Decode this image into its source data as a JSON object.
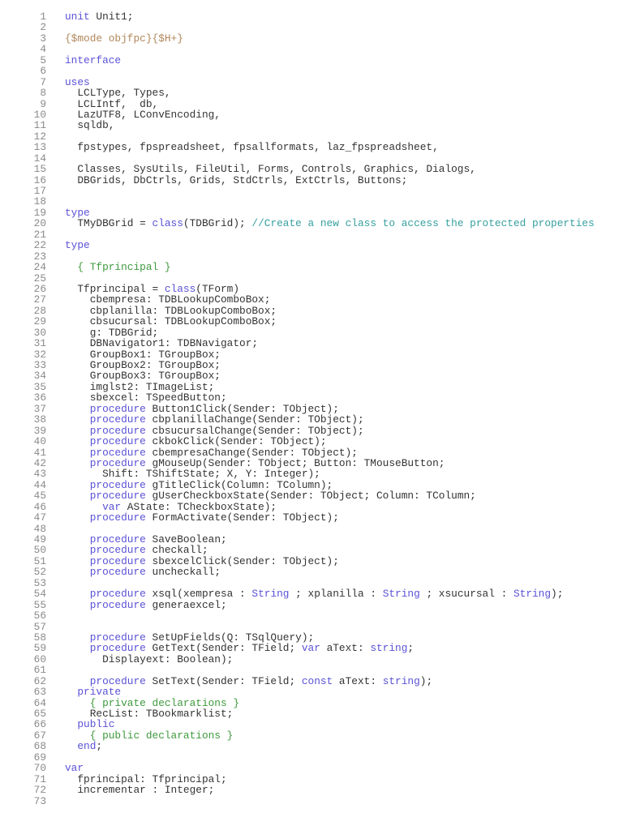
{
  "colors": {
    "keyword": "#5a52d6",
    "directive": "#b0875a",
    "comment_brace": "#3f9a3f",
    "comment_line": "#37a0a0",
    "text": "#333333",
    "line_number": "#8a8a8a"
  },
  "lines": [
    {
      "n": "1",
      "tokens": [
        [
          "k",
          "unit"
        ],
        [
          "p",
          " Unit1;"
        ]
      ]
    },
    {
      "n": "2",
      "tokens": []
    },
    {
      "n": "3",
      "tokens": [
        [
          "d",
          "{$mode objfpc}{$H+}"
        ]
      ]
    },
    {
      "n": "4",
      "tokens": []
    },
    {
      "n": "5",
      "tokens": [
        [
          "k",
          "interface"
        ]
      ]
    },
    {
      "n": "6",
      "tokens": []
    },
    {
      "n": "7",
      "tokens": [
        [
          "k",
          "uses"
        ]
      ]
    },
    {
      "n": "8",
      "tokens": [
        [
          "p",
          "  LCLType, Types,"
        ]
      ]
    },
    {
      "n": "9",
      "tokens": [
        [
          "p",
          "  LCLIntf,  db,"
        ]
      ]
    },
    {
      "n": "10",
      "tokens": [
        [
          "p",
          "  LazUTF8, LConvEncoding,"
        ]
      ]
    },
    {
      "n": "11",
      "tokens": [
        [
          "p",
          "  sqldb,"
        ]
      ]
    },
    {
      "n": "12",
      "tokens": []
    },
    {
      "n": "13",
      "tokens": [
        [
          "p",
          "  fpstypes, fpspreadsheet, fpsallformats, laz_fpspreadsheet,"
        ]
      ]
    },
    {
      "n": "14",
      "tokens": []
    },
    {
      "n": "15",
      "tokens": [
        [
          "p",
          "  Classes, SysUtils, FileUtil, Forms, Controls, Graphics, Dialogs,"
        ]
      ]
    },
    {
      "n": "16",
      "tokens": [
        [
          "p",
          "  DBGrids, DbCtrls, Grids, StdCtrls, ExtCtrls, Buttons;"
        ]
      ]
    },
    {
      "n": "17",
      "tokens": []
    },
    {
      "n": "18",
      "tokens": []
    },
    {
      "n": "19",
      "tokens": [
        [
          "k",
          "type"
        ]
      ]
    },
    {
      "n": "20",
      "tokens": [
        [
          "p",
          "  TMyDBGrid = "
        ],
        [
          "k",
          "class"
        ],
        [
          "p",
          "(TDBGrid); "
        ],
        [
          "t",
          "//Create a new class to access the protected properties"
        ]
      ]
    },
    {
      "n": "21",
      "tokens": []
    },
    {
      "n": "22",
      "tokens": [
        [
          "k",
          "type"
        ]
      ]
    },
    {
      "n": "23",
      "tokens": []
    },
    {
      "n": "24",
      "tokens": [
        [
          "c",
          "  { Tfprincipal }"
        ]
      ]
    },
    {
      "n": "25",
      "tokens": []
    },
    {
      "n": "26",
      "tokens": [
        [
          "p",
          "  Tfprincipal = "
        ],
        [
          "k",
          "class"
        ],
        [
          "p",
          "(TForm)"
        ]
      ]
    },
    {
      "n": "27",
      "tokens": [
        [
          "p",
          "    cbempresa: TDBLookupComboBox;"
        ]
      ]
    },
    {
      "n": "28",
      "tokens": [
        [
          "p",
          "    cbplanilla: TDBLookupComboBox;"
        ]
      ]
    },
    {
      "n": "29",
      "tokens": [
        [
          "p",
          "    cbsucursal: TDBLookupComboBox;"
        ]
      ]
    },
    {
      "n": "30",
      "tokens": [
        [
          "p",
          "    g: TDBGrid;"
        ]
      ]
    },
    {
      "n": "31",
      "tokens": [
        [
          "p",
          "    DBNavigator1: TDBNavigator;"
        ]
      ]
    },
    {
      "n": "32",
      "tokens": [
        [
          "p",
          "    GroupBox1: TGroupBox;"
        ]
      ]
    },
    {
      "n": "33",
      "tokens": [
        [
          "p",
          "    GroupBox2: TGroupBox;"
        ]
      ]
    },
    {
      "n": "34",
      "tokens": [
        [
          "p",
          "    GroupBox3: TGroupBox;"
        ]
      ]
    },
    {
      "n": "35",
      "tokens": [
        [
          "p",
          "    imglst2: TImageList;"
        ]
      ]
    },
    {
      "n": "36",
      "tokens": [
        [
          "p",
          "    sbexcel: TSpeedButton;"
        ]
      ]
    },
    {
      "n": "37",
      "tokens": [
        [
          "p",
          "    "
        ],
        [
          "k",
          "procedure"
        ],
        [
          "p",
          " Button1Click(Sender: TObject);"
        ]
      ]
    },
    {
      "n": "38",
      "tokens": [
        [
          "p",
          "    "
        ],
        [
          "k",
          "procedure"
        ],
        [
          "p",
          " cbplanillaChange(Sender: TObject);"
        ]
      ]
    },
    {
      "n": "39",
      "tokens": [
        [
          "p",
          "    "
        ],
        [
          "k",
          "procedure"
        ],
        [
          "p",
          " cbsucursalChange(Sender: TObject);"
        ]
      ]
    },
    {
      "n": "40",
      "tokens": [
        [
          "p",
          "    "
        ],
        [
          "k",
          "procedure"
        ],
        [
          "p",
          " ckbokClick(Sender: TObject);"
        ]
      ]
    },
    {
      "n": "41",
      "tokens": [
        [
          "p",
          "    "
        ],
        [
          "k",
          "procedure"
        ],
        [
          "p",
          " cbempresaChange(Sender: TObject);"
        ]
      ]
    },
    {
      "n": "42",
      "tokens": [
        [
          "p",
          "    "
        ],
        [
          "k",
          "procedure"
        ],
        [
          "p",
          " gMouseUp(Sender: TObject; Button: TMouseButton;"
        ]
      ]
    },
    {
      "n": "43",
      "tokens": [
        [
          "p",
          "      Shift: TShiftState; X, Y: Integer);"
        ]
      ]
    },
    {
      "n": "44",
      "tokens": [
        [
          "p",
          "    "
        ],
        [
          "k",
          "procedure"
        ],
        [
          "p",
          " gTitleClick(Column: TColumn);"
        ]
      ]
    },
    {
      "n": "45",
      "tokens": [
        [
          "p",
          "    "
        ],
        [
          "k",
          "procedure"
        ],
        [
          "p",
          " gUserCheckboxState(Sender: TObject; Column: TColumn;"
        ]
      ]
    },
    {
      "n": "46",
      "tokens": [
        [
          "p",
          "      "
        ],
        [
          "k",
          "var"
        ],
        [
          "p",
          " AState: TCheckboxState);"
        ]
      ]
    },
    {
      "n": "47",
      "tokens": [
        [
          "p",
          "    "
        ],
        [
          "k",
          "procedure"
        ],
        [
          "p",
          " FormActivate(Sender: TObject);"
        ]
      ]
    },
    {
      "n": "48",
      "tokens": []
    },
    {
      "n": "49",
      "tokens": [
        [
          "p",
          "    "
        ],
        [
          "k",
          "procedure"
        ],
        [
          "p",
          " SaveBoolean;"
        ]
      ]
    },
    {
      "n": "50",
      "tokens": [
        [
          "p",
          "    "
        ],
        [
          "k",
          "procedure"
        ],
        [
          "p",
          " checkall;"
        ]
      ]
    },
    {
      "n": "51",
      "tokens": [
        [
          "p",
          "    "
        ],
        [
          "k",
          "procedure"
        ],
        [
          "p",
          " sbexcelClick(Sender: TObject);"
        ]
      ]
    },
    {
      "n": "52",
      "tokens": [
        [
          "p",
          "    "
        ],
        [
          "k",
          "procedure"
        ],
        [
          "p",
          " uncheckall;"
        ]
      ]
    },
    {
      "n": "53",
      "tokens": []
    },
    {
      "n": "54",
      "tokens": [
        [
          "p",
          "    "
        ],
        [
          "k",
          "procedure"
        ],
        [
          "p",
          " xsql(xempresa : "
        ],
        [
          "k",
          "String"
        ],
        [
          "p",
          " ; xplanilla : "
        ],
        [
          "k",
          "String"
        ],
        [
          "p",
          " ; xsucursal : "
        ],
        [
          "k",
          "String"
        ],
        [
          "p",
          ");"
        ]
      ]
    },
    {
      "n": "55",
      "tokens": [
        [
          "p",
          "    "
        ],
        [
          "k",
          "procedure"
        ],
        [
          "p",
          " generaexcel;"
        ]
      ]
    },
    {
      "n": "56",
      "tokens": []
    },
    {
      "n": "57",
      "tokens": []
    },
    {
      "n": "58",
      "tokens": [
        [
          "p",
          "    "
        ],
        [
          "k",
          "procedure"
        ],
        [
          "p",
          " SetUpFields(Q: TSqlQuery);"
        ]
      ]
    },
    {
      "n": "59",
      "tokens": [
        [
          "p",
          "    "
        ],
        [
          "k",
          "procedure"
        ],
        [
          "p",
          " GetText(Sender: TField; "
        ],
        [
          "k",
          "var"
        ],
        [
          "p",
          " aText: "
        ],
        [
          "k",
          "string"
        ],
        [
          "p",
          ";"
        ]
      ]
    },
    {
      "n": "60",
      "tokens": [
        [
          "p",
          "      Displayext: Boolean);"
        ]
      ]
    },
    {
      "n": "61",
      "tokens": []
    },
    {
      "n": "62",
      "tokens": [
        [
          "p",
          "    "
        ],
        [
          "k",
          "procedure"
        ],
        [
          "p",
          " SetText(Sender: TField; "
        ],
        [
          "k",
          "const"
        ],
        [
          "p",
          " aText: "
        ],
        [
          "k",
          "string"
        ],
        [
          "p",
          ");"
        ]
      ]
    },
    {
      "n": "63",
      "tokens": [
        [
          "p",
          "  "
        ],
        [
          "k",
          "private"
        ]
      ]
    },
    {
      "n": "64",
      "tokens": [
        [
          "c",
          "    { private declarations }"
        ]
      ]
    },
    {
      "n": "65",
      "tokens": [
        [
          "p",
          "    RecList: TBookmarklist;"
        ]
      ]
    },
    {
      "n": "66",
      "tokens": [
        [
          "p",
          "  "
        ],
        [
          "k",
          "public"
        ]
      ]
    },
    {
      "n": "67",
      "tokens": [
        [
          "c",
          "    { public declarations }"
        ]
      ]
    },
    {
      "n": "68",
      "tokens": [
        [
          "p",
          "  "
        ],
        [
          "k",
          "end"
        ],
        [
          "p",
          ";"
        ]
      ]
    },
    {
      "n": "69",
      "tokens": []
    },
    {
      "n": "70",
      "tokens": [
        [
          "k",
          "var"
        ]
      ]
    },
    {
      "n": "71",
      "tokens": [
        [
          "p",
          "  fprincipal: Tfprincipal;"
        ]
      ]
    },
    {
      "n": "72",
      "tokens": [
        [
          "p",
          "  incrementar : Integer;"
        ]
      ]
    },
    {
      "n": "73",
      "tokens": []
    }
  ]
}
